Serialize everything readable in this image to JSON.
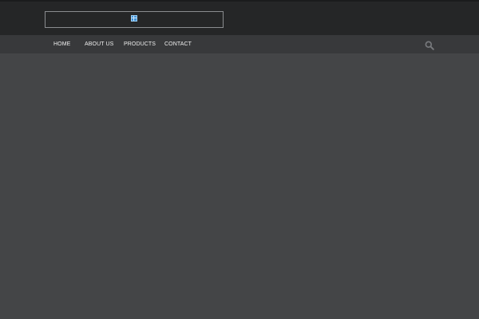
{
  "nav": {
    "items": [
      {
        "label": "HOME"
      },
      {
        "label": "ABOUT US"
      },
      {
        "label": "PRODUCTS"
      },
      {
        "label": "CONTACT"
      }
    ]
  },
  "icons": {
    "logo": "broken-image-icon",
    "search": "search-icon"
  },
  "colors": {
    "header_bg": "#252627",
    "nav_bg": "#38393b",
    "page_bg": "#444547",
    "nav_text": "#eeeeee"
  }
}
